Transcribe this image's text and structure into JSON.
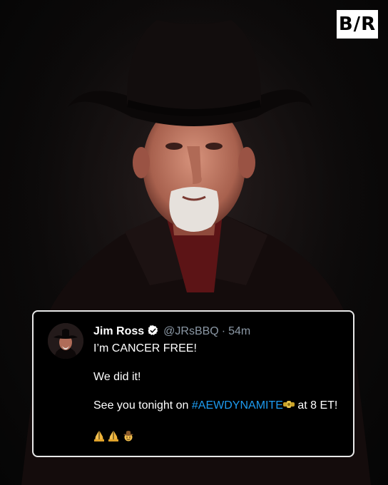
{
  "brand": {
    "logo_text": "B/R"
  },
  "tweet": {
    "name": "Jim Ross",
    "handle": "@JRsBBQ",
    "separator": "·",
    "time": "54m",
    "line1": "I’m CANCER FREE!",
    "line2": "We did it!",
    "line3_prefix": "See you tonight on ",
    "hashtag": "#AEWDYNAMITE",
    "line3_suffix": " at 8 ET!",
    "emojis": [
      "folded-hands",
      "folded-hands",
      "cowboy-face"
    ]
  },
  "colors": {
    "hashtag": "#1d9bf0",
    "handle": "#8b98a5",
    "tweet_background": "#000000",
    "tweet_border": "#e8e8e8"
  },
  "icons": [
    "verified-badge-icon",
    "belt-emoji-icon",
    "folded-hands-icon",
    "cowboy-face-icon"
  ]
}
